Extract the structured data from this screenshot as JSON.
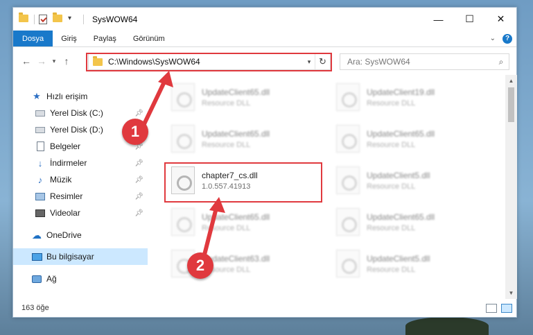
{
  "window": {
    "title": "SysWOW64",
    "controls": {
      "minimize": "—",
      "maximize": "☐",
      "close": "✕"
    }
  },
  "ribbon": {
    "tabs": [
      "Dosya",
      "Giriş",
      "Paylaş",
      "Görünüm"
    ],
    "expand_icon": "chevron-down-icon",
    "help": "?"
  },
  "address": {
    "path": "C:\\Windows\\SysWOW64",
    "search_placeholder": "Ara: SysWOW64"
  },
  "nav": {
    "items": [
      {
        "label": "Hızlı erişim",
        "icon": "star-icon",
        "pinned": false
      },
      {
        "label": "Yerel Disk (C:)",
        "icon": "drive-icon",
        "pinned": true
      },
      {
        "label": "Yerel Disk (D:)",
        "icon": "drive-icon",
        "pinned": true
      },
      {
        "label": "Belgeler",
        "icon": "documents-icon",
        "pinned": true
      },
      {
        "label": "İndirmeler",
        "icon": "downloads-icon",
        "pinned": true
      },
      {
        "label": "Müzik",
        "icon": "music-icon",
        "pinned": true
      },
      {
        "label": "Resimler",
        "icon": "pictures-icon",
        "pinned": true
      },
      {
        "label": "Videolar",
        "icon": "videos-icon",
        "pinned": true
      },
      {
        "label": "OneDrive",
        "icon": "cloud-icon",
        "pinned": false
      },
      {
        "label": "Bu bilgisayar",
        "icon": "computer-icon",
        "pinned": false,
        "selected": true
      },
      {
        "label": "Ağ",
        "icon": "network-icon",
        "pinned": false
      }
    ]
  },
  "files": [
    {
      "name": "UpdateClient65.dll",
      "type": "Resource DLL",
      "blurred": true
    },
    {
      "name": "UpdateClient19.dll",
      "type": "Resource DLL",
      "blurred": true
    },
    {
      "name": "UpdateClient65.dll",
      "type": "Resource DLL",
      "blurred": true
    },
    {
      "name": "UpdateClient65.dll",
      "type": "Resource DLL",
      "blurred": true
    },
    {
      "name": "chapter7_cs.dll",
      "type": "1.0.557.41913",
      "blurred": false
    },
    {
      "name": "UpdateClient5.dll",
      "type": "Resource DLL",
      "blurred": true
    },
    {
      "name": "UpdateClient65.dll",
      "type": "Resource DLL",
      "blurred": true
    },
    {
      "name": "UpdateClient65.dll",
      "type": "Resource DLL",
      "blurred": true
    },
    {
      "name": "UpdateClient63.dll",
      "type": "Resource DLL",
      "blurred": true
    },
    {
      "name": "UpdateClient5.dll",
      "type": "Resource DLL",
      "blurred": true
    }
  ],
  "status": {
    "count": "163 öğe"
  },
  "callouts": [
    "1",
    "2"
  ],
  "colors": {
    "accent": "#1979ca",
    "highlight": "#e0393e",
    "selected_bg": "#cce8ff"
  }
}
